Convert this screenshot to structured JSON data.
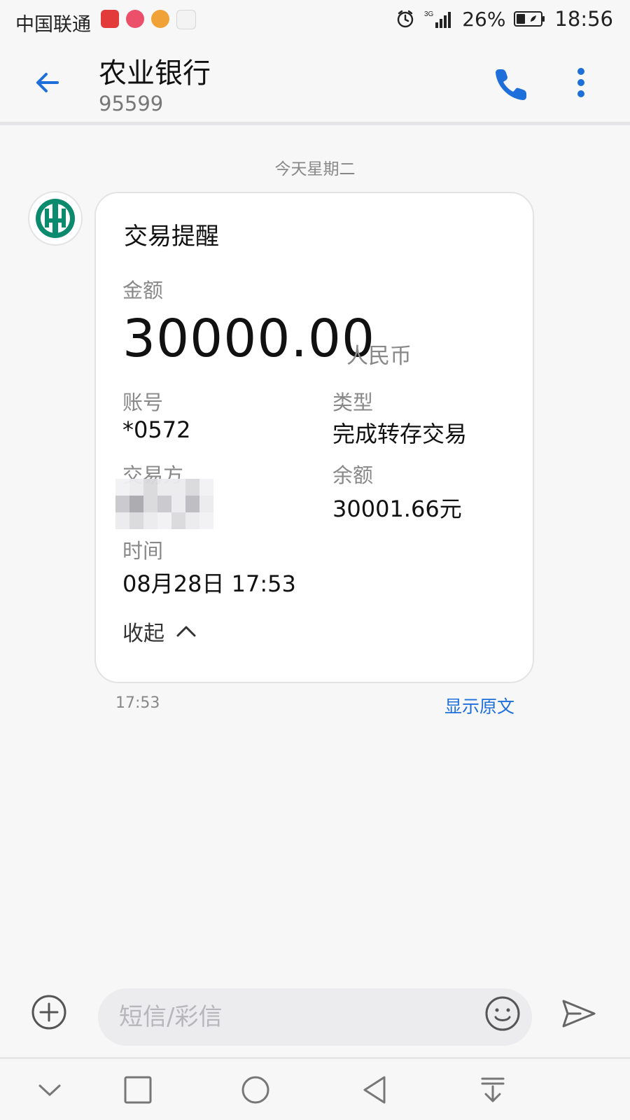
{
  "status_bar": {
    "carrier": "中国联通",
    "battery_percent": "26%",
    "time": "18:56",
    "network": "3G"
  },
  "header": {
    "title": "农业银行",
    "subtitle": "95599"
  },
  "chat": {
    "date_separator": "今天星期二",
    "message": {
      "card_title": "交易提醒",
      "amount_label": "金额",
      "amount": "30000.00",
      "currency": "人民币",
      "account_label": "账号",
      "account": "*0572",
      "type_label": "类型",
      "type": "完成转存交易",
      "counterparty_label": "交易方",
      "balance_label": "余额",
      "balance": "30001.66元",
      "time_label": "时间",
      "time": "08月28日 17:53",
      "collapse_label": "收起",
      "timestamp": "17:53",
      "show_original_label": "显示原文"
    }
  },
  "composer": {
    "placeholder": "短信/彩信"
  },
  "colors": {
    "accent": "#1e6fd9",
    "bank_green": "#0b8a6d",
    "background": "#f7f7f8"
  },
  "icons": {
    "back": "back-arrow-icon",
    "call": "phone-icon",
    "more": "more-vertical-icon",
    "add": "add-circle-icon",
    "emoji": "emoji-icon",
    "send": "send-icon",
    "alarm": "alarm-icon",
    "signal": "signal-icon",
    "battery": "battery-icon"
  }
}
